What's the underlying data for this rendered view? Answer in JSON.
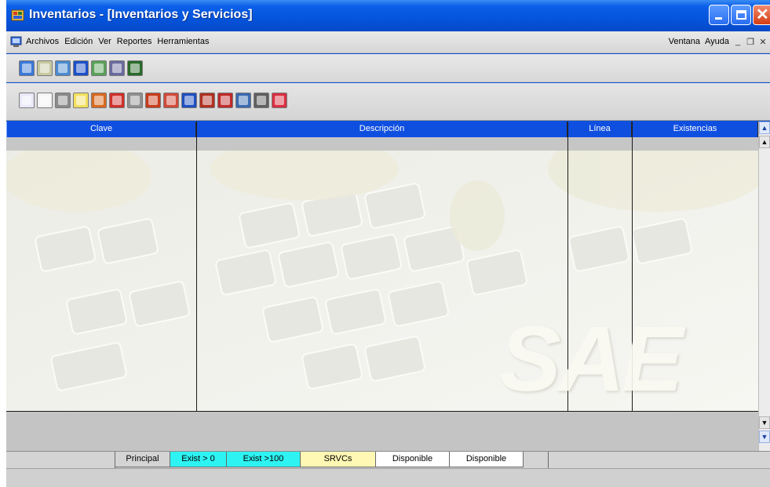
{
  "window": {
    "title": "Inventarios - [Inventarios y Servicios]",
    "colors": {
      "titlebar": "#0554dc",
      "grid_header": "#0f4fe0"
    }
  },
  "menubar": {
    "items": [
      "Archivos",
      "Edición",
      "Ver",
      "Reportes",
      "Herramientas"
    ],
    "right_items": [
      "Ventana",
      "Ayuda"
    ]
  },
  "toolbar1": {
    "icons": [
      "catalog-icon",
      "grid-icon",
      "refresh-icon",
      "help-icon",
      "folder-icon",
      "document-icon",
      "exit-door-icon"
    ]
  },
  "toolbar2": {
    "icons": [
      "edit-icon",
      "new-document-icon",
      "house-icon",
      "highlight-icon",
      "copy-icon",
      "undo-icon",
      "printer-icon",
      "clip-icon",
      "report-icon",
      "info-icon",
      "warehouse-icon",
      "chart-icon",
      "table-icon",
      "package-icon",
      "flag-icon"
    ]
  },
  "grid": {
    "columns": [
      "Clave",
      "Descripción",
      "Línea",
      "Existencias"
    ],
    "watermark": "SAE"
  },
  "tabs": [
    {
      "label": "Principal",
      "style": "active"
    },
    {
      "label": "Exist > 0",
      "style": "cyan"
    },
    {
      "label": "Exist >100",
      "style": "cyan"
    },
    {
      "label": "SRVCs",
      "style": "yellow"
    },
    {
      "label": "Disponible",
      "style": "white"
    },
    {
      "label": "Disponible",
      "style": "white"
    }
  ]
}
